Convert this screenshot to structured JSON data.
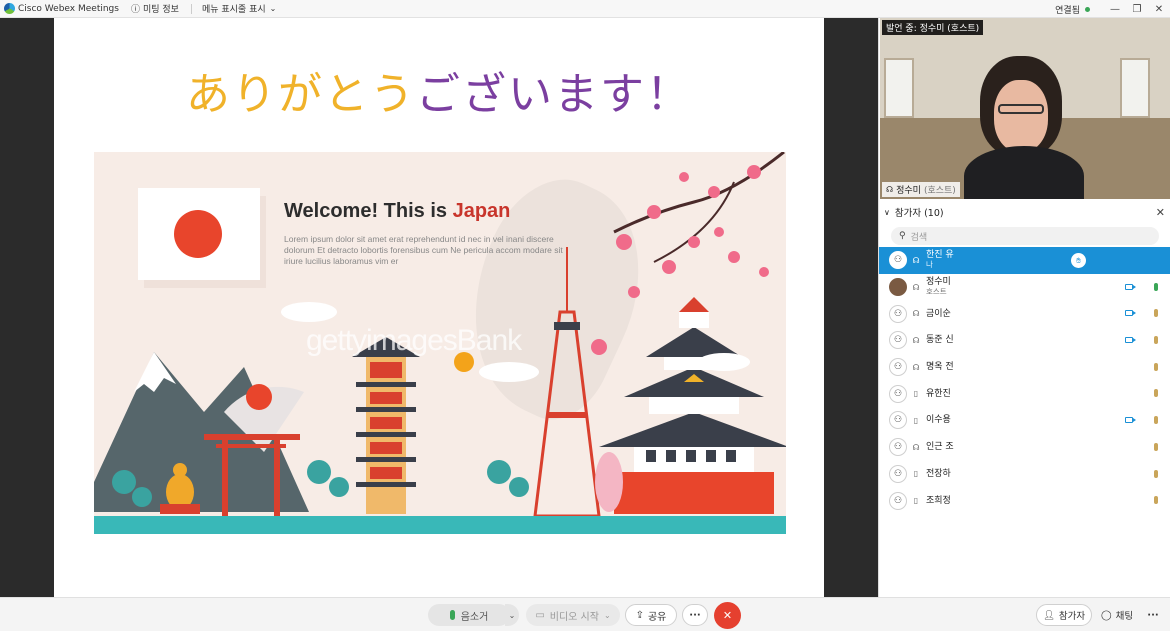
{
  "titlebar": {
    "app_name": "Cisco Webex Meetings",
    "meeting_info": "미팅 정보",
    "menu_toggle": "메뉴 표시줄 표시",
    "connection": "연결됨"
  },
  "slide": {
    "title_part1": "ありがとう",
    "title_part2": "ございます！",
    "poster_heading_prefix": "Welcome! This is ",
    "poster_heading_accent": "Japan",
    "poster_body": "Lorem ipsum dolor sit amet erat reprehendunt id nec in vel inani discere dolorum Et detracto lobortis forensibus cum Ne pericula accom modare sit iriure lucilius laboramus vim er",
    "watermark": "gettyimagesBank"
  },
  "video": {
    "speaking_label": "발언 중: 정수미 (호스트)",
    "name": "정수미",
    "host_tag": "(호스트)"
  },
  "participants": {
    "header": "참가자 (10)",
    "search_placeholder": "검색",
    "items": [
      {
        "name": "한진 유",
        "sub": "나",
        "selected": true,
        "device": "audio",
        "hand": true,
        "camera": false,
        "mic": "none"
      },
      {
        "name": "정수미",
        "sub": "호스트",
        "selected": false,
        "device": "audio",
        "hand": false,
        "camera": true,
        "mic": "on"
      },
      {
        "name": "금이순",
        "sub": "",
        "selected": false,
        "device": "audio",
        "hand": false,
        "camera": true,
        "mic": "muted"
      },
      {
        "name": "동준 신",
        "sub": "",
        "selected": false,
        "device": "audio",
        "hand": false,
        "camera": true,
        "mic": "muted"
      },
      {
        "name": "명옥 전",
        "sub": "",
        "selected": false,
        "device": "audio",
        "hand": false,
        "camera": false,
        "mic": "muted"
      },
      {
        "name": "유한진",
        "sub": "",
        "selected": false,
        "device": "phone",
        "hand": false,
        "camera": false,
        "mic": "muted"
      },
      {
        "name": "이수용",
        "sub": "",
        "selected": false,
        "device": "phone",
        "hand": false,
        "camera": true,
        "mic": "muted"
      },
      {
        "name": "인근 조",
        "sub": "",
        "selected": false,
        "device": "audio",
        "hand": false,
        "camera": false,
        "mic": "muted"
      },
      {
        "name": "전장하",
        "sub": "",
        "selected": false,
        "device": "phone",
        "hand": false,
        "camera": false,
        "mic": "muted"
      },
      {
        "name": "조희정",
        "sub": "",
        "selected": false,
        "device": "phone",
        "hand": false,
        "camera": false,
        "mic": "muted"
      }
    ]
  },
  "controls": {
    "mute_label": "음소거",
    "video_label": "비디오 시작",
    "share_label": "공유",
    "more_label": "···",
    "leave_label": "✕",
    "participants_label": "참가자",
    "chat_label": "채팅",
    "overflow_label": "···"
  },
  "colors": {
    "accent_blue": "#1a90d6",
    "title_yellow": "#f0b22a",
    "title_purple": "#7b3fa0",
    "leave_red": "#e5402f",
    "mic_green": "#3aa657"
  }
}
